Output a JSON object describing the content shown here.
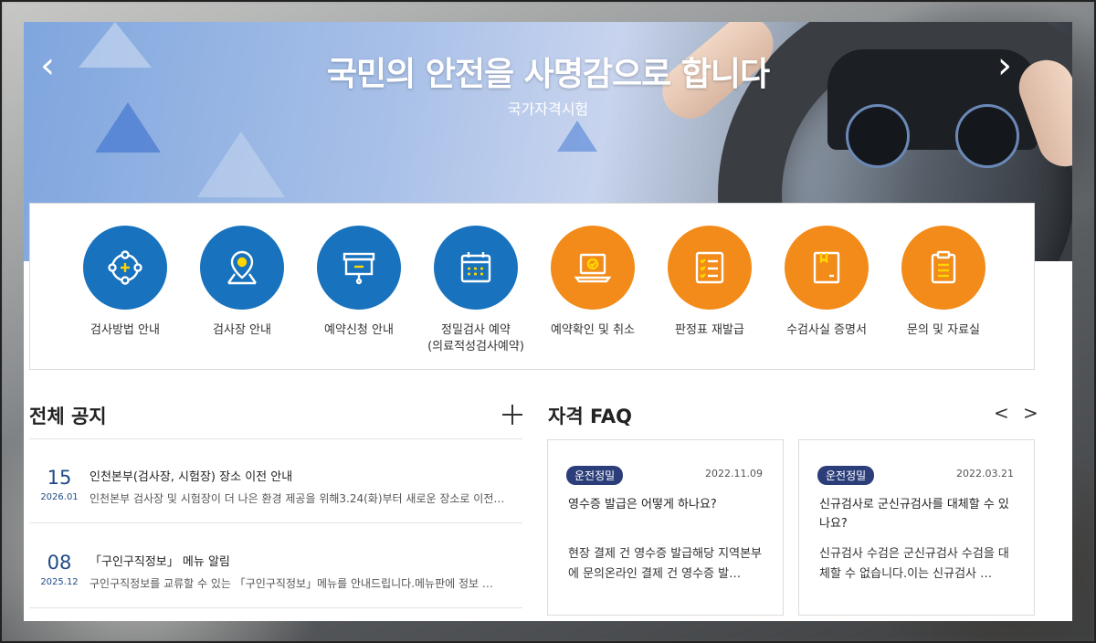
{
  "hero": {
    "title": "국민의 안전을 사명감으로 합니다",
    "subtitle": "국가자격시험",
    "prev_arrow": "‹",
    "next_arrow": "›"
  },
  "quick_menu": [
    {
      "label": "검사방법 안내",
      "icon": "target-crosshair-icon",
      "color": "blue"
    },
    {
      "label": "검사장 안내",
      "icon": "map-pin-icon",
      "color": "blue"
    },
    {
      "label": "예약신청 안내",
      "icon": "presentation-board-icon",
      "color": "blue"
    },
    {
      "label": "정밀검사 예약\n(의료적성검사예약)",
      "icon": "calendar-icon",
      "color": "blue"
    },
    {
      "label": "예약확인 및 취소",
      "icon": "laptop-check-icon",
      "color": "orange"
    },
    {
      "label": "판정표 재발급",
      "icon": "checklist-icon",
      "color": "orange"
    },
    {
      "label": "수검사실 증명서",
      "icon": "document-box-icon",
      "color": "orange"
    },
    {
      "label": "문의 및 자료실",
      "icon": "clipboard-icon",
      "color": "orange"
    }
  ],
  "notices": {
    "title": "전체 공지",
    "items": [
      {
        "day": "15",
        "year_month": "2026.01",
        "title": "인천본부(검사장, 시험장) 장소 이전 안내",
        "description": "인천본부 검사장 및 시험장이 더 나은 환경 제공을 위해3.24(화)부터 새로운 장소로 이전…"
      },
      {
        "day": "08",
        "year_month": "2025.12",
        "title": "「구인구직정보」 메뉴 알림",
        "description": "구인구직정보를 교류할 수 있는 「구인구직정보」메뉴를 안내드립니다.메뉴판에 정보 …"
      }
    ]
  },
  "faq": {
    "title": "자격 FAQ",
    "prev_arrow": "<",
    "next_arrow": ">",
    "items": [
      {
        "badge": "운전정밀",
        "date": "2022.11.09",
        "question": "영수증 발급은 어떻게 하나요?",
        "answer": "현장 결제 건 영수증 발급해당 지역본부에 문의온라인 결제 건 영수증 발…"
      },
      {
        "badge": "운전정밀",
        "date": "2022.03.21",
        "question": "신규검사로 군신규검사를 대체할 수 있나요?",
        "answer": "신규검사 수검은 군신규검사 수검을 대체할 수 없습니다.이는 신규검사 …"
      }
    ]
  },
  "colors": {
    "blue": "#1872bd",
    "orange": "#f28b1a",
    "badge": "#2c3e7a",
    "date_text": "#1f4a86"
  }
}
